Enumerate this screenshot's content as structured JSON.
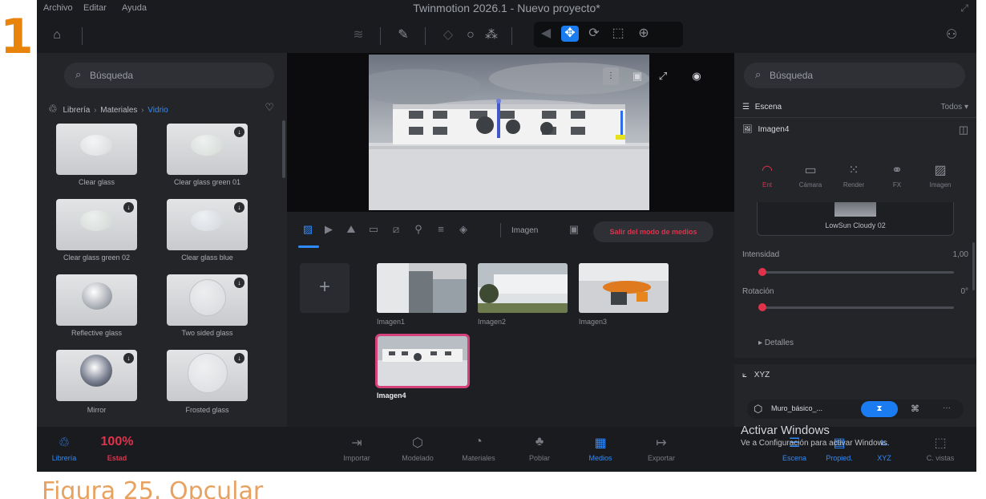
{
  "outer": {
    "section_number": "1",
    "caption": "Figura 25. Opcular"
  },
  "menu": [
    "Archivo",
    "Editar",
    "Ayuda"
  ],
  "app_title": "Twinmotion 2026.1 - Nuevo proyecto*",
  "left_panel": {
    "search_placeholder": "Búsqueda",
    "breadcrumb": [
      "Librería",
      "Materiales",
      "Vidrio"
    ],
    "materials": [
      {
        "label": "Clear glass",
        "download": false
      },
      {
        "label": "Clear glass green 01",
        "download": true
      },
      {
        "label": "Clear glass green 02",
        "download": true
      },
      {
        "label": "Clear glass blue",
        "download": true
      },
      {
        "label": "Reflective glass",
        "download": false
      },
      {
        "label": "Two sided glass",
        "download": true
      },
      {
        "label": "Mirror",
        "download": true
      },
      {
        "label": "Frosted glass",
        "download": true
      }
    ]
  },
  "media": {
    "mode_label": "Imagen",
    "exit_button": "Salir del modo de medios",
    "thumbnails": [
      {
        "label": "Imagen1",
        "selected": false
      },
      {
        "label": "Imagen2",
        "selected": false
      },
      {
        "label": "Imagen3",
        "selected": false
      },
      {
        "label": "Imagen4",
        "selected": true
      }
    ]
  },
  "right_panel": {
    "search_placeholder": "Búsqueda",
    "scene_label": "Escena",
    "filter_label": "Todos",
    "object_label": "Imagen4",
    "tabs": [
      {
        "label": "Ent",
        "icon": "environment-icon",
        "active": true
      },
      {
        "label": "Cámara",
        "icon": "camera-icon",
        "active": false
      },
      {
        "label": "Render",
        "icon": "render-icon",
        "active": false
      },
      {
        "label": "FX",
        "icon": "fx-icon",
        "active": false
      },
      {
        "label": "Imagen",
        "icon": "image-icon",
        "active": false
      }
    ],
    "sky_name": "LowSun Cloudy 02",
    "intensity": {
      "label": "Intensidad",
      "value": "1,00",
      "fraction": 0.0
    },
    "rotation": {
      "label": "Rotación",
      "value": "0°",
      "fraction": 0.0
    },
    "details_label": "Detalles",
    "xyz_label": "XYZ",
    "object_row_label": "Muro_básico_...",
    "more_label": "···"
  },
  "bottom_bar": {
    "left": [
      {
        "label": "Librería",
        "active": true
      },
      {
        "label": "Estad",
        "value": "100%"
      }
    ],
    "center": [
      {
        "label": "Importar",
        "active": false
      },
      {
        "label": "Modelado",
        "active": false
      },
      {
        "label": "Materiales",
        "active": false
      },
      {
        "label": "Poblar",
        "active": false
      },
      {
        "label": "Medios",
        "active": true
      },
      {
        "label": "Exportar",
        "active": false
      }
    ],
    "right": [
      {
        "label": "Escena",
        "active": true
      },
      {
        "label": "Propied.",
        "active": true
      },
      {
        "label": "XYZ",
        "active": true
      },
      {
        "label": "C. vistas",
        "active": false
      }
    ]
  },
  "windows_overlay": {
    "title": "Activar Windows",
    "subtitle": "Ve a Configuración para activar Windows."
  },
  "colors": {
    "accent_blue": "#1a7cf0",
    "accent_red": "#e0324b",
    "selection_pink": "#d4417b",
    "number_orange": "#e8830c"
  }
}
